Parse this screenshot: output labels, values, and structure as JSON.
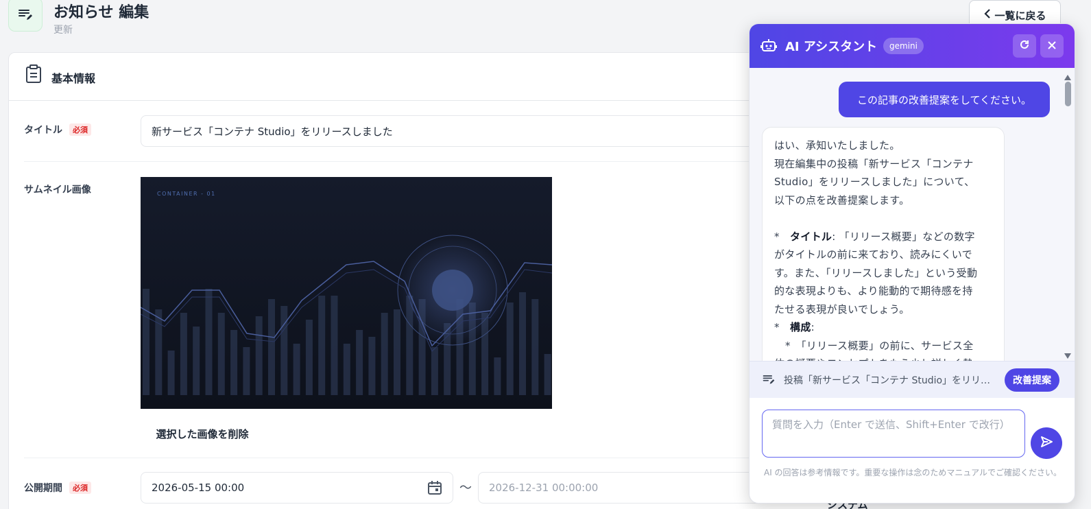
{
  "header": {
    "title": "お知らせ 編集",
    "subtitle": "更新",
    "back_label": "一覧に戻る"
  },
  "card": {
    "section_title": "基本情報",
    "required_label": "必須",
    "title_label": "タイトル",
    "title_value": "新サービス「コンテナ Studio」をリリースしました",
    "thumbnail_label": "サムネイル画像",
    "thumbnail_caption": "CONTAINER - 01",
    "delete_image_label": "選択した画像を削除",
    "period_label": "公開期間",
    "period_start": "2026-05-15 00:00",
    "period_separator": "〜",
    "period_end_placeholder": "2026-12-31 00:00:00"
  },
  "ai": {
    "title": "AI アシスタント",
    "model_badge": "gemini",
    "user_message": "この記事の改善提案をしてください。",
    "reply": {
      "l1": "はい、承知いたしました。",
      "l2": "現在編集中の投稿「新サービス「コンテナ",
      "l3": "Studio」をリリースしました」について、",
      "l4": "以下の点を改善提案します。",
      "b1_marker": "*",
      "b1_bold": "タイトル",
      "b1_text": ": 「リリース概要」などの数字",
      "l6": "がタイトルの前に来ており、読みにくいで",
      "l7": "す。また、「リリースしました」という受動",
      "l8": "的な表現よりも、より能動的で期待感を持",
      "l9": "たせる表現が良いでしょう。",
      "b2_marker": "*",
      "b2_bold": "構成",
      "b2_text": ":",
      "l11": "*　「リリース概要」の前に、サービス全",
      "l12": "体の概要やコンセプトをもう少し詳しく熱"
    },
    "context_text": "投稿「新サービス「コンテナ Studio」をリリースしました」",
    "context_button": "改善提案",
    "input_placeholder": "質問を入力（Enter で送信、Shift+Enter で改行）",
    "disclaimer": "AI の回答は参考情報です。重要な操作は念のためマニュアルでご確認ください。"
  },
  "peek_label": "システム",
  "chart_data": {
    "type": "bar",
    "title": "CONTAINER - 01",
    "values": [
      62,
      50,
      26,
      48,
      40,
      62,
      48,
      38,
      28,
      46,
      56,
      52,
      30,
      44,
      58,
      58,
      30,
      38,
      34,
      48,
      50,
      58,
      56,
      28,
      42,
      56,
      54,
      48,
      22,
      54,
      60,
      56,
      24
    ]
  },
  "colors": {
    "accent": "#4f46e5",
    "accent_end": "#7c3aed",
    "required": "#dc2626"
  }
}
